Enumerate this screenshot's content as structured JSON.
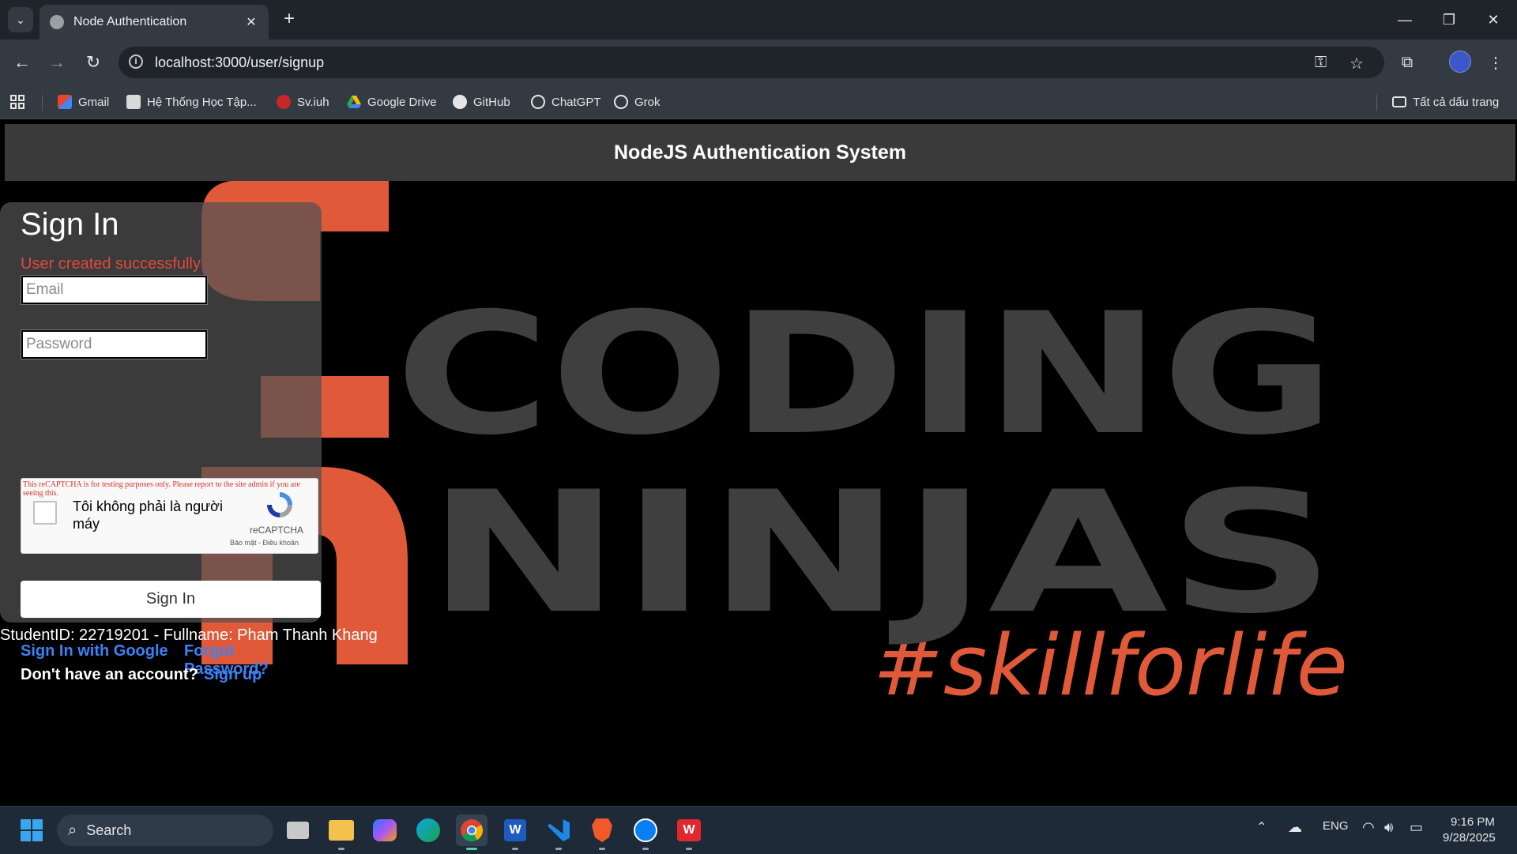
{
  "browser": {
    "tab_title": "Node Authentication",
    "url": "localhost:3000/user/signup",
    "bookmarks": [
      {
        "label": "Gmail",
        "icon": "gmail-icon"
      },
      {
        "label": "Hệ Thống Học Tập...",
        "icon": "lms-icon"
      },
      {
        "label": "Sv.iuh",
        "icon": "svIUH-icon"
      },
      {
        "label": "Google Drive",
        "icon": "google-drive-icon"
      },
      {
        "label": "GitHub",
        "icon": "github-icon"
      },
      {
        "label": "ChatGPT",
        "icon": "chatgpt-icon"
      },
      {
        "label": "Grok",
        "icon": "grok-icon"
      }
    ],
    "all_bookmarks": "Tất cả dấu trang"
  },
  "app": {
    "header_title": "NodeJS Authentication System",
    "background_logo": {
      "line1": "CODING",
      "line2": "NINJAS",
      "tagline": "#skillforlife",
      "accent_color": "#e05a3a",
      "gray_color": "#3f3f3f"
    }
  },
  "signin": {
    "title": "Sign In",
    "success_message": "User created successfully",
    "email_placeholder": "Email",
    "password_placeholder": "Password",
    "recaptcha": {
      "warning": "This reCAPTCHA is for testing purposes only. Please report to the site admin if you are seeing this.",
      "label": "Tôi không phải là người máy",
      "brand": "reCAPTCHA",
      "terms": "Bảo mật - Điều khoản"
    },
    "button_label": "Sign In",
    "google_link": "Sign In with Google",
    "forgot_link": "Forgot Password?",
    "no_account_text": "Don't have an account?",
    "signup_link": "Sign up"
  },
  "footer_text": "StudentID: 22719201 - Fullname: Pham Thanh Khang",
  "taskbar": {
    "search_label": "Search",
    "language": "ENG",
    "time": "9:16 PM",
    "date": "9/28/2025"
  }
}
